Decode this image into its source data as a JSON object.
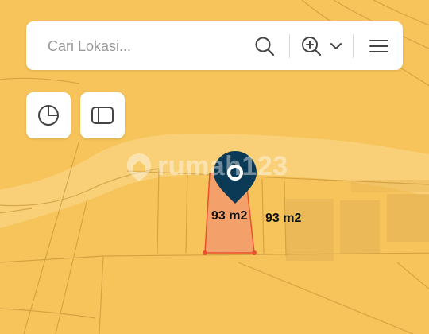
{
  "search": {
    "placeholder": "Cari Lokasi..."
  },
  "toolbar": {
    "search_icon": "search-icon",
    "zoom_icon": "zoom-in-icon",
    "dropdown_icon": "chevron-down-icon",
    "menu_icon": "hamburger-menu-icon"
  },
  "map_controls": {
    "stats_icon": "pie-chart-icon",
    "sidebar_icon": "sidebar-toggle-icon"
  },
  "parcels": {
    "selected_label": "93 m2",
    "adjacent_label": "93 m2"
  },
  "watermark": {
    "text": "rumah123"
  },
  "colors": {
    "map_background": "#f6c45a",
    "selected_parcel_fill": "#f4a06a",
    "parcel_vertex": "#e8502e",
    "marker": "#0b3a57",
    "building": "#e8b656"
  }
}
